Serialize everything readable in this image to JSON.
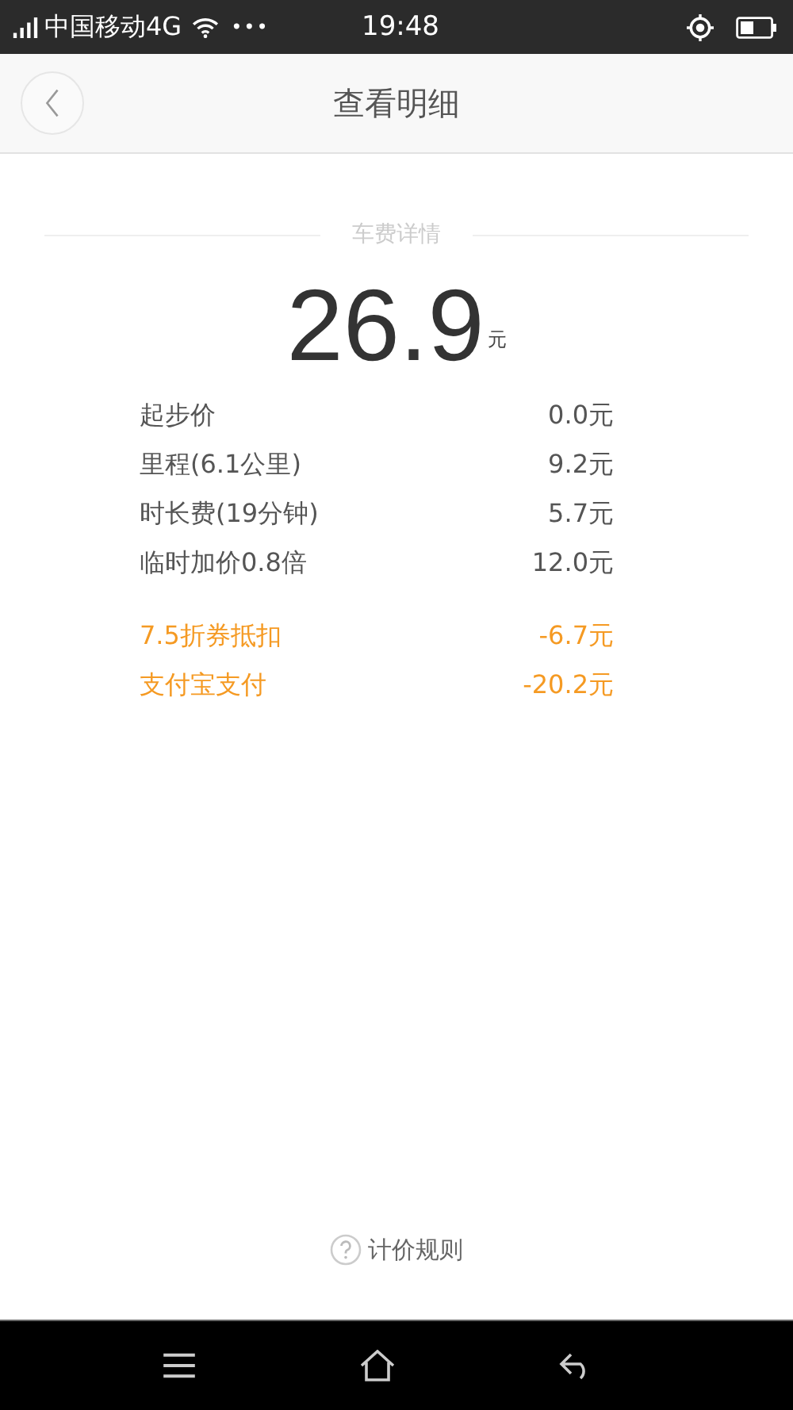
{
  "status_bar": {
    "carrier": "中国移动4G",
    "more": "•••",
    "time": "19:48"
  },
  "header": {
    "title": "查看明细"
  },
  "section_title": "车费详情",
  "total": {
    "amount": "26.9",
    "unit": "元"
  },
  "items": [
    {
      "label": "起步价",
      "value": "0.0元",
      "kind": "charge"
    },
    {
      "label": "里程(6.1公里)",
      "value": "9.2元",
      "kind": "charge"
    },
    {
      "label": "时长费(19分钟)",
      "value": "5.7元",
      "kind": "charge"
    },
    {
      "label": "临时加价0.8倍",
      "value": "12.0元",
      "kind": "charge"
    },
    {
      "label": "7.5折券抵扣",
      "value": "-6.7元",
      "kind": "discount"
    },
    {
      "label": "支付宝支付",
      "value": "-20.2元",
      "kind": "discount"
    }
  ],
  "footer_link": "计价规则"
}
